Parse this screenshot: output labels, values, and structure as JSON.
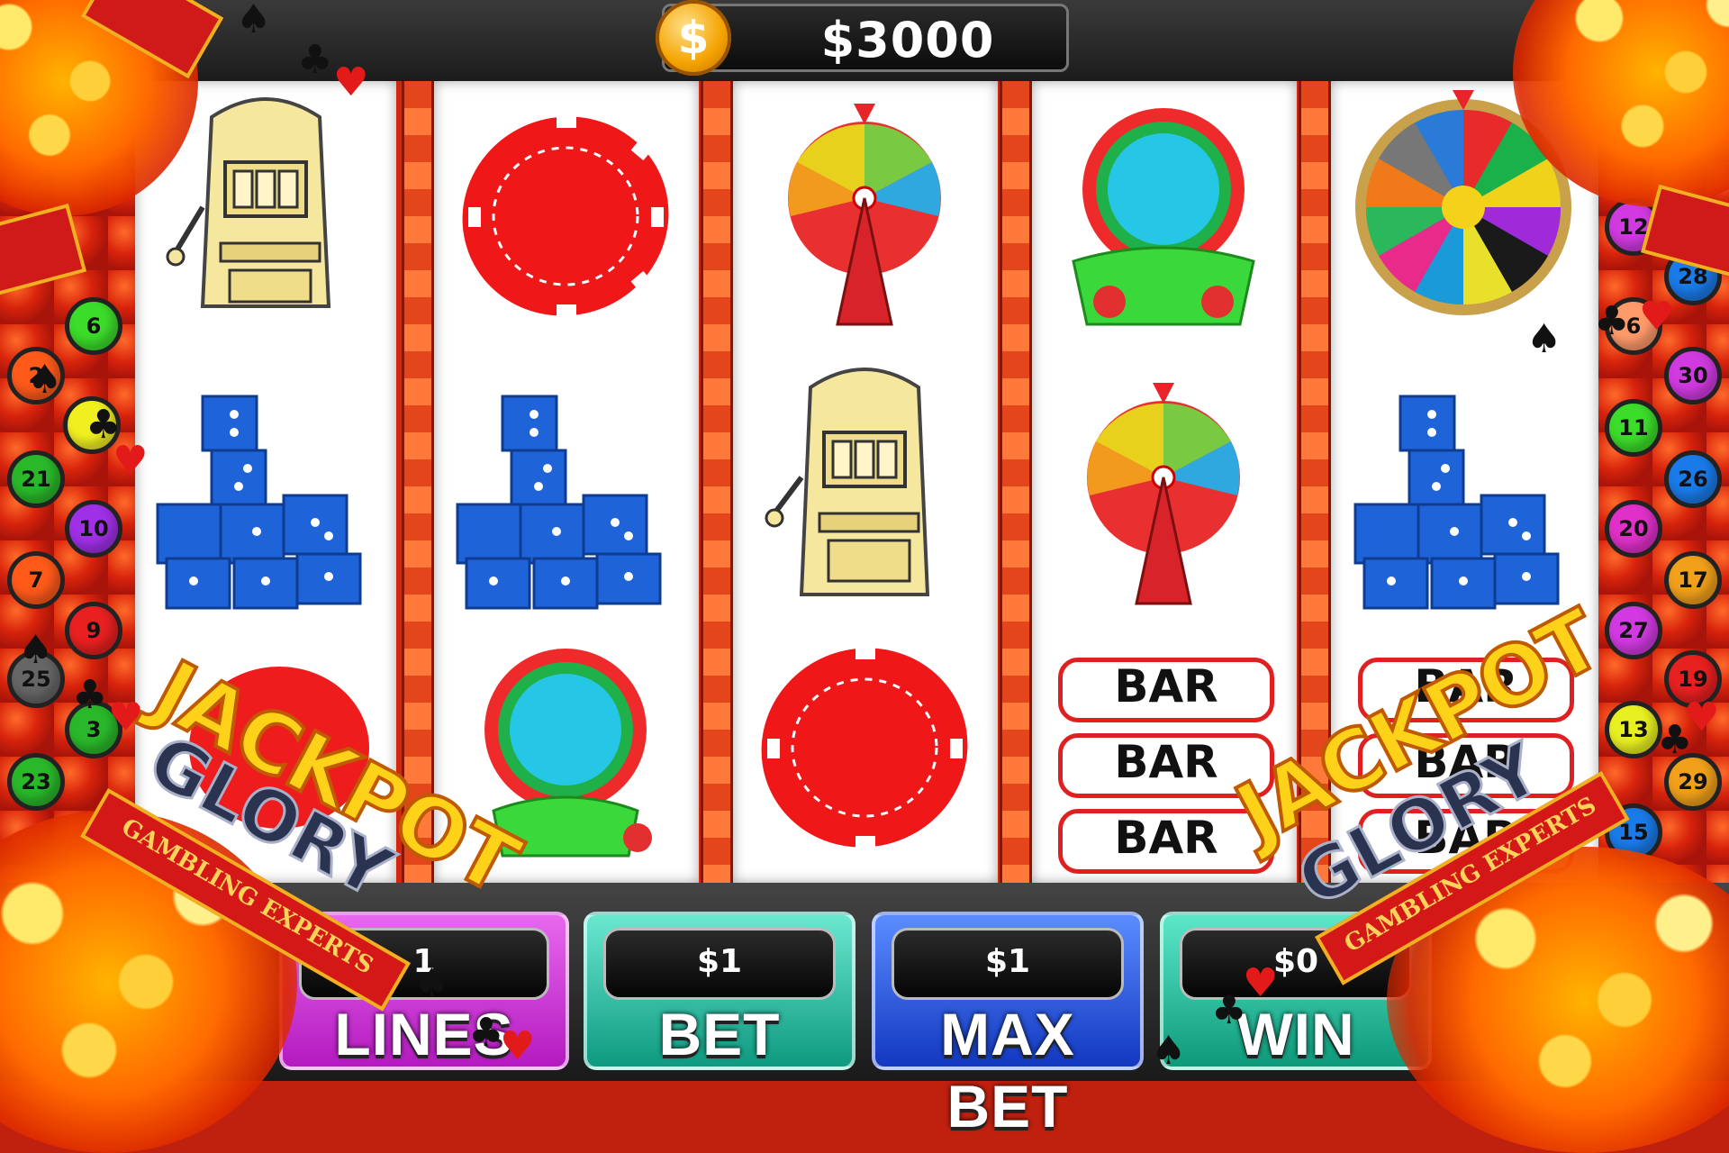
{
  "header": {
    "balance": "$3000",
    "coin_glyph": "$"
  },
  "reels": [
    [
      "slot-machine",
      "dice-stack",
      "jackpot-chip"
    ],
    [
      "poker-chip",
      "dice-stack",
      "bonus-wheel-green"
    ],
    [
      "prize-wheel-rainbow",
      "slot-machine",
      "poker-chip"
    ],
    [
      "bonus-wheel-green",
      "prize-wheel-rainbow",
      "triple-bar"
    ],
    [
      "fortune-wheel",
      "dice-stack",
      "triple-bar"
    ]
  ],
  "bar_symbol_text": "BAR",
  "controls": {
    "lines": {
      "value": "1",
      "label": "LINES"
    },
    "bet": {
      "value": "$1",
      "label": "BET"
    },
    "max_bet": {
      "value": "$1",
      "label": "MAX BET"
    },
    "win": {
      "value": "$0",
      "label": "WIN"
    }
  },
  "logo": {
    "line1": "JACKPOT",
    "line2": "GLORY",
    "ribbon": "GAMBLING EXPERTS"
  },
  "left_balls": [
    "6",
    "2",
    "",
    "21",
    "10",
    "7",
    "9",
    "25",
    "3",
    "23"
  ],
  "right_balls": [
    "12",
    "28",
    "6",
    "30",
    "11",
    "26",
    "20",
    "17",
    "27",
    "19",
    "13",
    "29",
    "15"
  ],
  "colors": {
    "lines_button": "#d23ad8",
    "bet_button": "#1fb89a",
    "max_bet_button": "#1a4fd8",
    "win_button": "#14b898",
    "reel_frame": "#d2260e"
  }
}
